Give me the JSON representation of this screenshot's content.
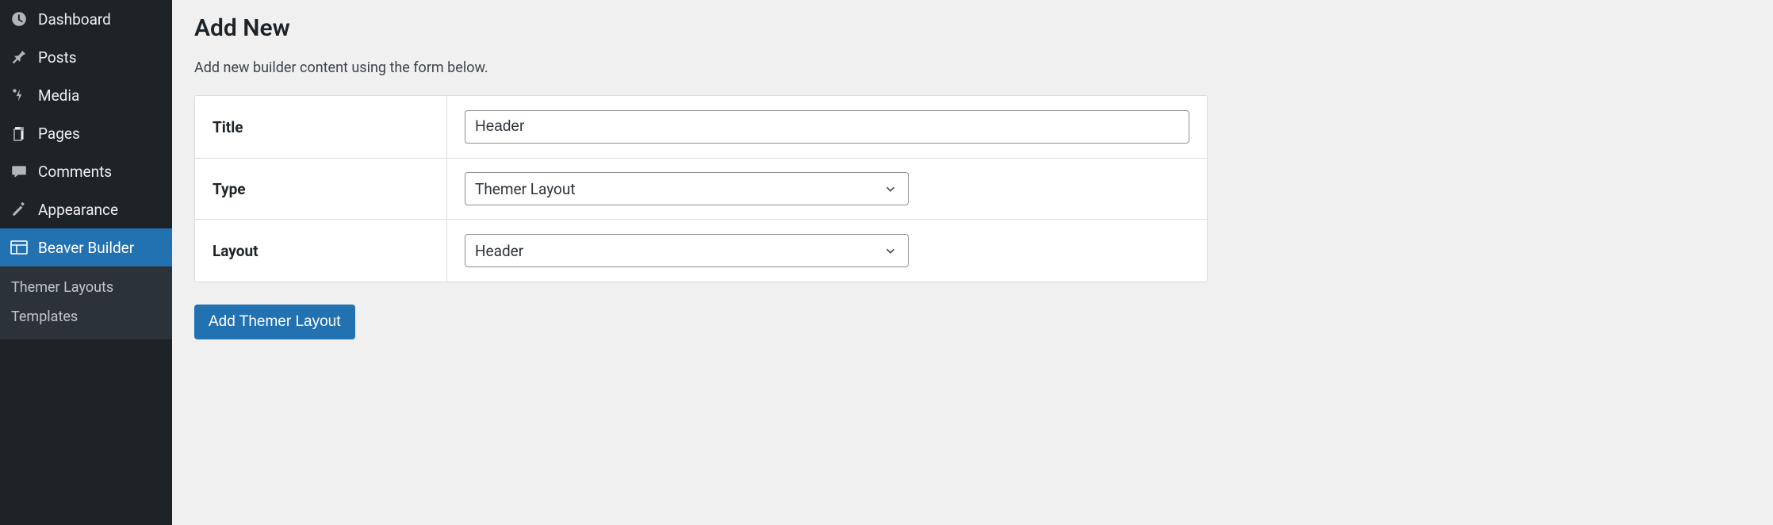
{
  "sidebar": {
    "menu": [
      {
        "icon": "dashboard-icon",
        "label": "Dashboard"
      },
      {
        "icon": "pin-icon",
        "label": "Posts"
      },
      {
        "icon": "media-icon",
        "label": "Media"
      },
      {
        "icon": "page-icon",
        "label": "Pages"
      },
      {
        "icon": "comment-icon",
        "label": "Comments"
      },
      {
        "icon": "appearance-icon",
        "label": "Appearance"
      },
      {
        "icon": "builder-icon",
        "label": "Beaver Builder",
        "current": true
      }
    ],
    "submenu": [
      {
        "label": "Themer Layouts"
      },
      {
        "label": "Templates"
      }
    ]
  },
  "page": {
    "title": "Add New",
    "description": "Add new builder content using the form below."
  },
  "form": {
    "rows": {
      "title": {
        "label": "Title",
        "value": "Header"
      },
      "type": {
        "label": "Type",
        "value": "Themer Layout"
      },
      "layout": {
        "label": "Layout",
        "value": "Header"
      }
    },
    "submit_label": "Add Themer Layout"
  }
}
